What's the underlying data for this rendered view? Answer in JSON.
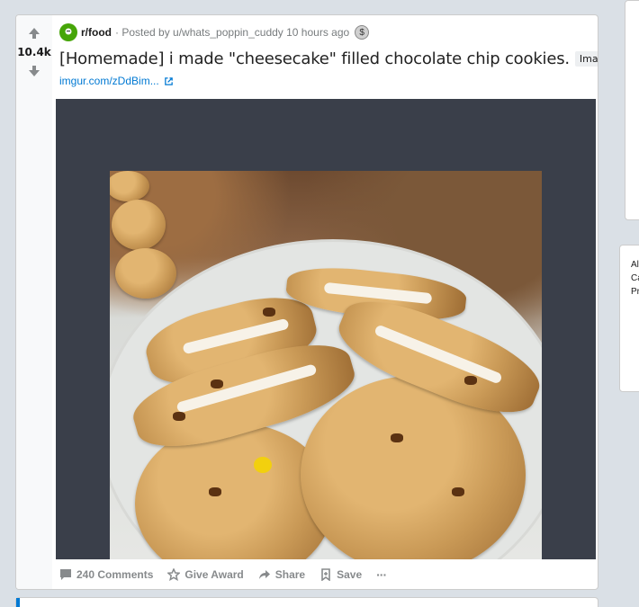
{
  "post": {
    "score": "10.4k",
    "subreddit": "r/food",
    "posted_by": "· Posted by u/whats_poppin_cuddy 10 hours ago",
    "award_glyph": "$",
    "title": "[Homemade] i made \"cheesecake\" filled chocolate chip cookies.",
    "flair": "Image",
    "link": "imgur.com/zDdBim...",
    "image_alt": "cheesecake filled chocolate chip cookies"
  },
  "actions": {
    "comments": "240 Comments",
    "give_award": "Give Award",
    "share": "Share",
    "save": "Save",
    "more": "···"
  },
  "sidebar": {
    "line1": "Al",
    "line2": "Ca",
    "line3": "Pr"
  },
  "icons": {
    "upvote": "arrow-up-icon",
    "downvote": "arrow-down-icon",
    "comment": "comment-icon",
    "award": "award-icon",
    "share": "share-icon",
    "save": "bookmark-icon",
    "external": "external-link-icon"
  },
  "colors": {
    "page_bg": "#dae0e6",
    "link_blue": "#0079d3",
    "media_bg": "#3a3f4a",
    "muted": "#878a8c"
  }
}
